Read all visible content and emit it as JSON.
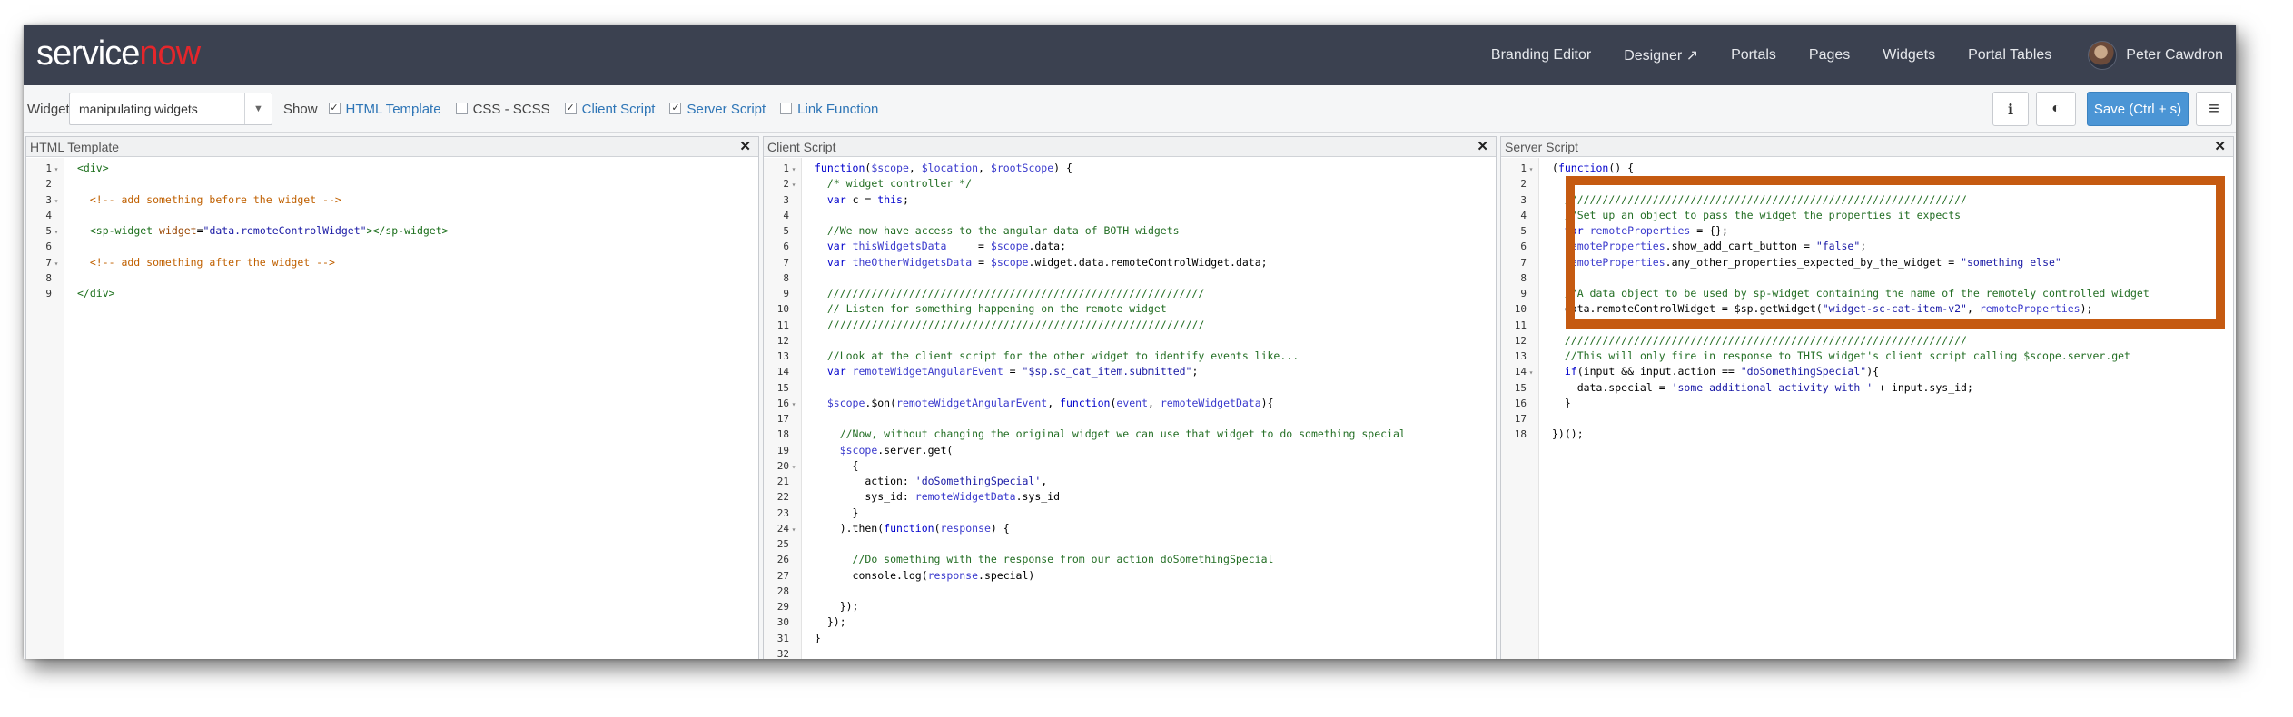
{
  "app": {
    "logo_service": "service",
    "logo_now": "now"
  },
  "nav": {
    "items": [
      "Branding Editor",
      "Designer ↗",
      "Portals",
      "Pages",
      "Widgets",
      "Portal Tables"
    ],
    "user": "Peter Cawdron"
  },
  "toolbar": {
    "widget_label": "Widget",
    "widget_value": "manipulating widgets",
    "show_label": "Show",
    "checkboxes": [
      {
        "label": "HTML Template",
        "checked": true
      },
      {
        "label": "CSS - SCSS",
        "checked": false
      },
      {
        "label": "Client Script",
        "checked": true
      },
      {
        "label": "Server Script",
        "checked": true
      },
      {
        "label": "Link Function",
        "checked": false
      }
    ],
    "save_label": "Save (Ctrl + s)",
    "info_icon": "i",
    "eye_icon": "◐",
    "menu_icon": "≡"
  },
  "panels": {
    "html": {
      "title": "HTML Template",
      "lines": [
        "<div>",
        "",
        "  <!-- add something before the widget -->",
        "",
        "  <sp-widget widget=\"data.remoteControlWidget\"></sp-widget>",
        "",
        "  <!-- add something after the widget -->",
        "",
        "</div>"
      ]
    },
    "client": {
      "title": "Client Script",
      "lines": [
        "function($scope, $location, $rootScope) {",
        "  /* widget controller */",
        "  var c = this;",
        "",
        "  //We now have access to the angular data of BOTH widgets",
        "  var thisWidgetsData     = $scope.data;",
        "  var theOtherWidgetsData = $scope.widget.data.remoteControlWidget.data;",
        "",
        "  ////////////////////////////////////////////////////////////",
        "  // Listen for something happening on the remote widget",
        "  ////////////////////////////////////////////////////////////",
        "",
        "  //Look at the client script for the other widget to identify events like...",
        "  var remoteWidgetAngularEvent = \"$sp.sc_cat_item.submitted\";",
        "",
        "  $scope.$on(remoteWidgetAngularEvent, function(event, remoteWidgetData){",
        "",
        "    //Now, without changing the original widget we can use that widget to do something special",
        "    $scope.server.get(",
        "      {",
        "        action: 'doSomethingSpecial',",
        "        sys_id: remoteWidgetData.sys_id",
        "      }",
        "    ).then(function(response) {",
        "",
        "      //Do something with the response from our action doSomethingSpecial",
        "      console.log(response.special)",
        "",
        "    });",
        "  });",
        "}",
        ""
      ]
    },
    "server": {
      "title": "Server Script",
      "lines": [
        "(function() {",
        "",
        "  ////////////////////////////////////////////////////////////////",
        "  //Set up an object to pass the widget the properties it expects",
        "  var remoteProperties = {};",
        "  remoteProperties.show_add_cart_button = \"false\";",
        "  remoteProperties.any_other_properties_expected_by_the_widget = \"something else\"",
        "",
        "  //A data object to be used by sp-widget containing the name of the remotely controlled widget",
        "  data.remoteControlWidget = $sp.getWidget(\"widget-sc-cat-item-v2\", remoteProperties);",
        "",
        "  ////////////////////////////////////////////////////////////////",
        "  //This will only fire in response to THIS widget's client script calling $scope.server.get",
        "  if(input && input.action == \"doSomethingSpecial\"){",
        "    data.special = 'some additional activity with ' + input.sys_id;",
        "  }",
        "",
        "})();"
      ]
    }
  }
}
